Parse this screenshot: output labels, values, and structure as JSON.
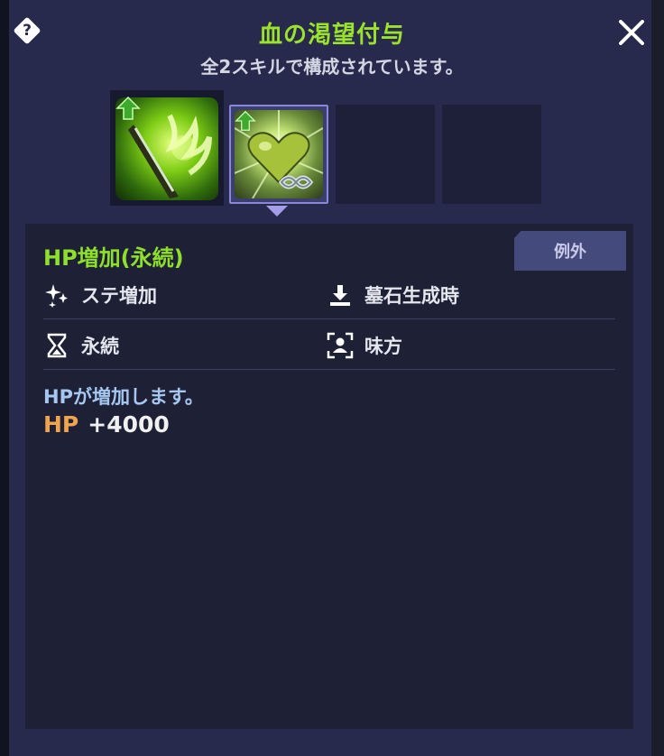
{
  "dialog": {
    "title": "血の渇望付与",
    "subtitle": "全2スキルで構成されています。"
  },
  "skill_slots": [
    {
      "state": "filled",
      "icon": "slash-skill-icon",
      "upgrade": true
    },
    {
      "state": "selected",
      "icon": "heart-infinity-skill-icon",
      "upgrade": true
    },
    {
      "state": "empty"
    },
    {
      "state": "empty"
    }
  ],
  "detail": {
    "tag": "例外",
    "name": "HP増加(永続)",
    "attributes": {
      "type": "ステ増加",
      "trigger": "墓石生成時",
      "duration": "永続",
      "target": "味方"
    },
    "description": "HPが増加します。",
    "stat": {
      "label": "HP",
      "value": "+4000"
    }
  },
  "colors": {
    "title": "#9be22b",
    "skill_name": "#8ee02a",
    "description": "#a6c8f0",
    "stat_label": "#f1a44e",
    "panel": "#1e2036",
    "dialog": "#272a4c"
  }
}
